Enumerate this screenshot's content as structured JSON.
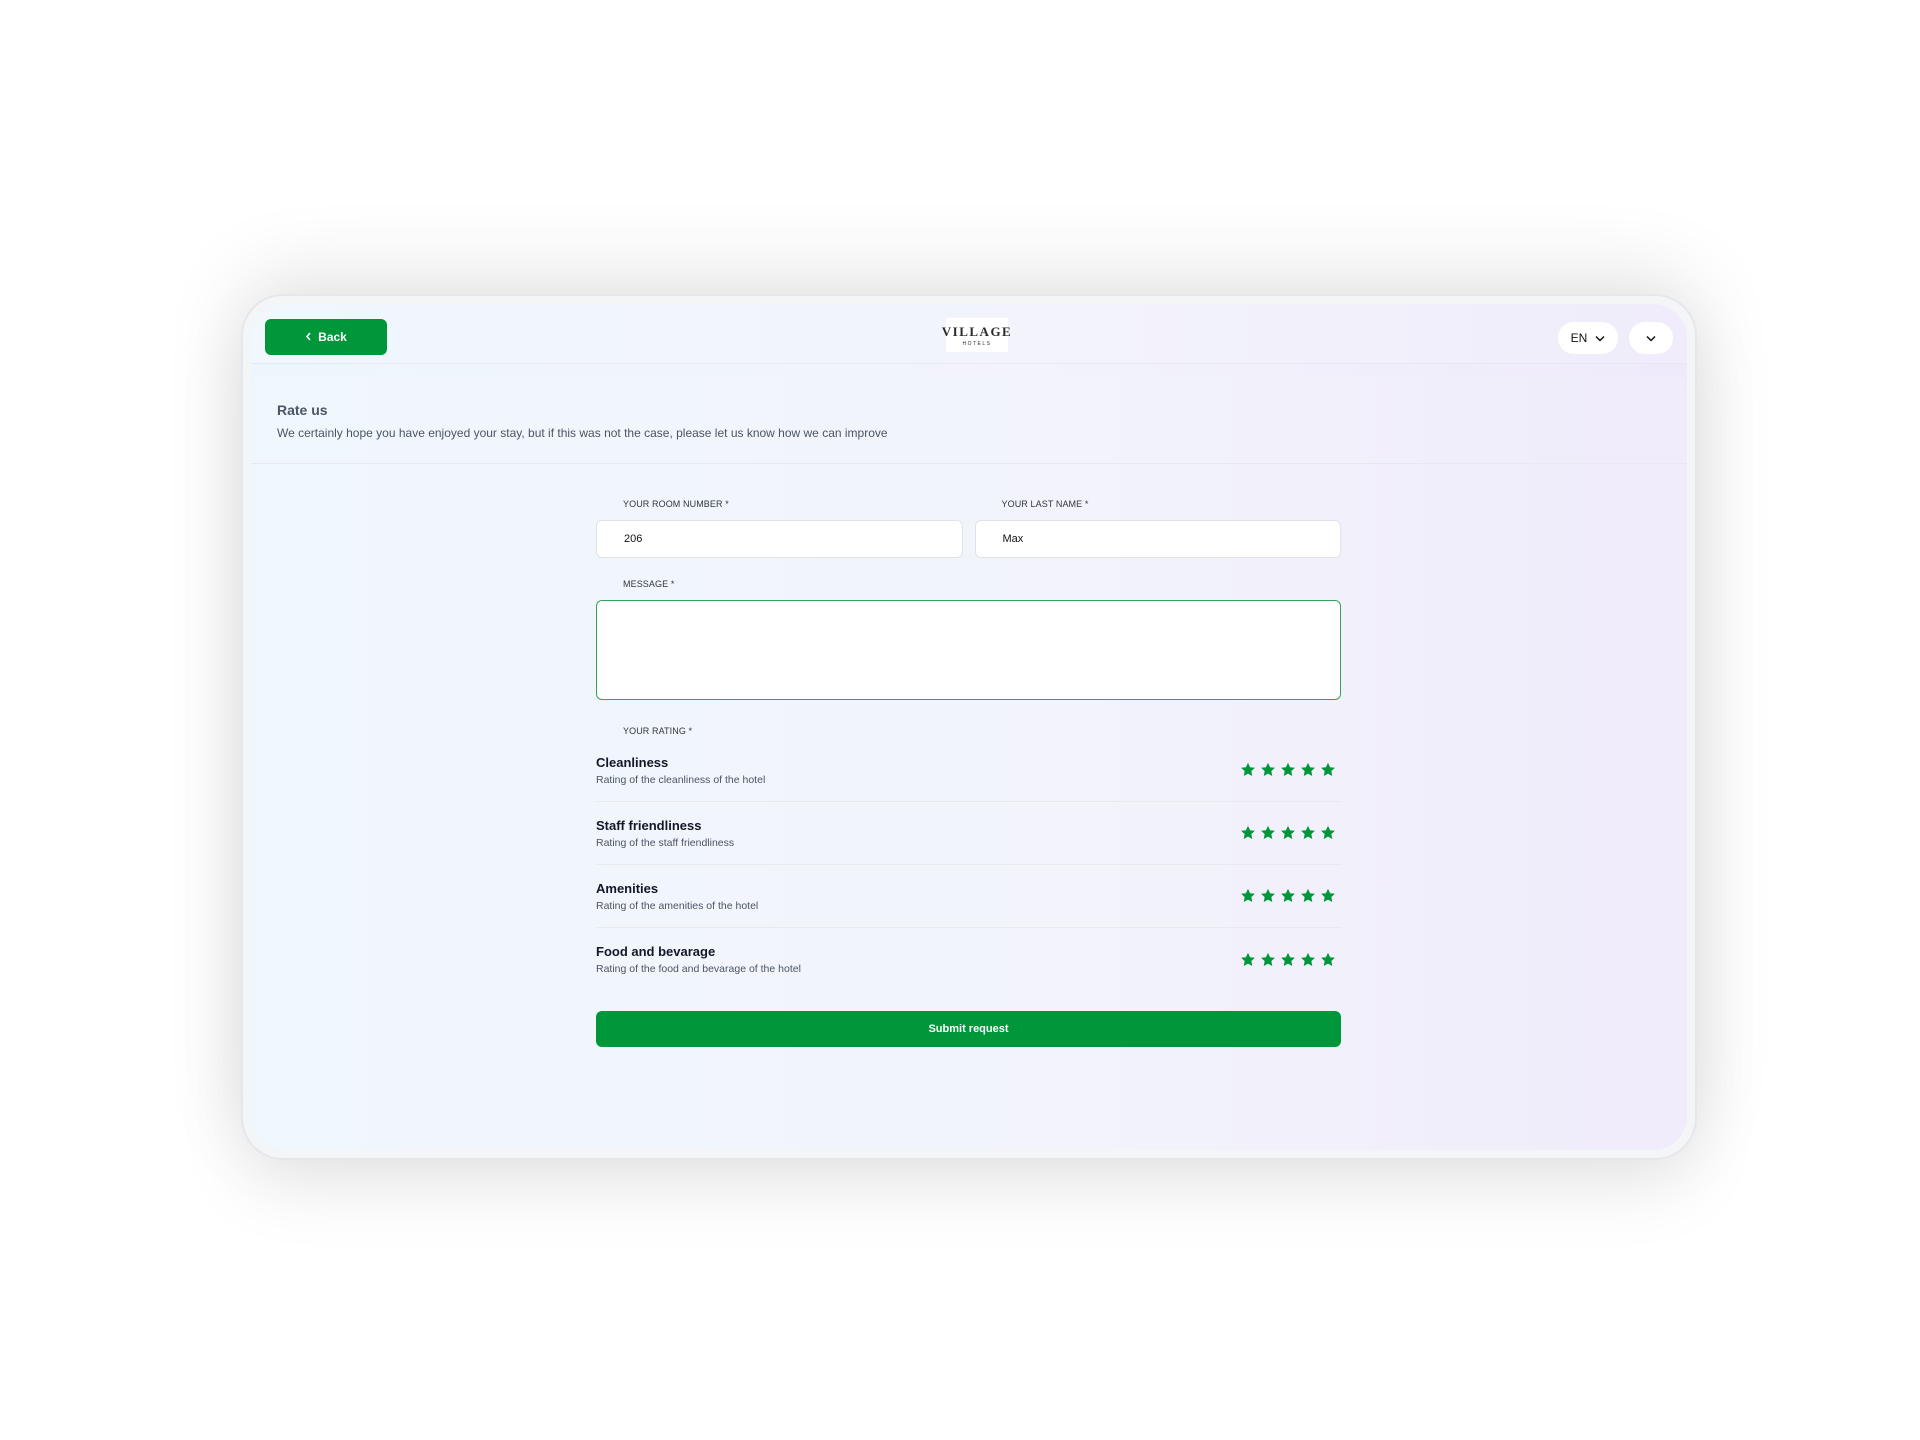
{
  "header": {
    "back_label": "Back",
    "logo_primary": "VILLAGE",
    "logo_secondary": "HOTELS",
    "language": "EN"
  },
  "section": {
    "title": "Rate us",
    "subtitle": "We certainly hope you have enjoyed your stay, but if this was not the case, please let us know how we can improve"
  },
  "form": {
    "room_label": "YOUR ROOM NUMBER *",
    "room_value": "206",
    "lastname_label": "YOUR LAST NAME *",
    "lastname_value": "Max",
    "message_label": "MESSAGE *",
    "message_value": "",
    "rating_label": "YOUR RATING *",
    "ratings": [
      {
        "title": "Cleanliness",
        "desc": "Rating of the cleanliness of the hotel",
        "stars": 5
      },
      {
        "title": "Staff friendliness",
        "desc": "Rating of the staff friendliness",
        "stars": 5
      },
      {
        "title": "Amenities",
        "desc": "Rating of the amenities of the hotel",
        "stars": 5
      },
      {
        "title": "Food and bevarage",
        "desc": "Rating of the food and bevarage of the hotel",
        "stars": 5
      }
    ],
    "submit_label": "Submit request"
  },
  "colors": {
    "accent": "#00963a",
    "star": "#00963a"
  },
  "icons": {
    "back": "chevron-left-icon",
    "lang": "chevron-down-icon",
    "menu": "chevron-down-icon",
    "star": "star-icon"
  }
}
